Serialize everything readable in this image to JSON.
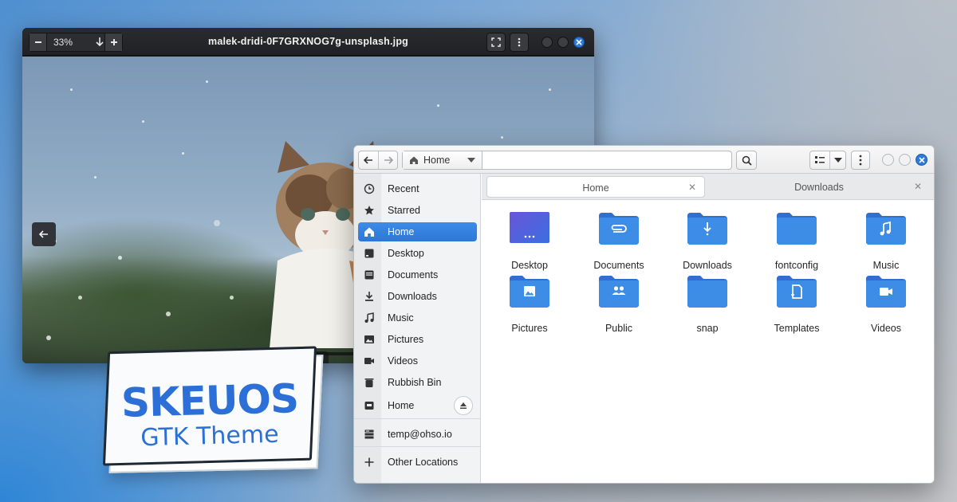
{
  "viewer": {
    "zoom": "33%",
    "title": "malek-dridi-0F7GRXNOG7g-unsplash.jpg"
  },
  "badge": {
    "title": "SKEUOS",
    "subtitle": "GTK Theme"
  },
  "files": {
    "path_home": "Home",
    "sidebar": [
      {
        "label": "Recent",
        "icon": "clock-icon"
      },
      {
        "label": "Starred",
        "icon": "star-icon"
      },
      {
        "label": "Home",
        "icon": "home-icon",
        "active": true
      },
      {
        "label": "Desktop",
        "icon": "desktop-icon"
      },
      {
        "label": "Documents",
        "icon": "document-icon"
      },
      {
        "label": "Downloads",
        "icon": "download-icon"
      },
      {
        "label": "Music",
        "icon": "music-icon"
      },
      {
        "label": "Pictures",
        "icon": "picture-icon"
      },
      {
        "label": "Videos",
        "icon": "video-icon"
      },
      {
        "label": "Rubbish Bin",
        "icon": "trash-icon"
      },
      {
        "label": "Home",
        "icon": "drive-icon"
      },
      {
        "label": "temp@ohso.io",
        "icon": "server-icon"
      },
      {
        "label": "Other Locations",
        "icon": "plus-icon"
      }
    ],
    "tabs": [
      {
        "label": "Home",
        "active": true
      },
      {
        "label": "Downloads",
        "active": false
      }
    ],
    "items": [
      {
        "name": "Desktop",
        "glyph": "desktop"
      },
      {
        "name": "Documents",
        "glyph": "clip"
      },
      {
        "name": "Downloads",
        "glyph": "download"
      },
      {
        "name": "fontconfig",
        "glyph": "none"
      },
      {
        "name": "Music",
        "glyph": "music"
      },
      {
        "name": "Pictures",
        "glyph": "picture"
      },
      {
        "name": "Public",
        "glyph": "people"
      },
      {
        "name": "snap",
        "glyph": "none"
      },
      {
        "name": "Templates",
        "glyph": "template"
      },
      {
        "name": "Videos",
        "glyph": "video"
      }
    ]
  },
  "colors": {
    "accent": "#3584e4",
    "folder": "#3d8ce6",
    "folder_back": "#2f6fd0"
  }
}
